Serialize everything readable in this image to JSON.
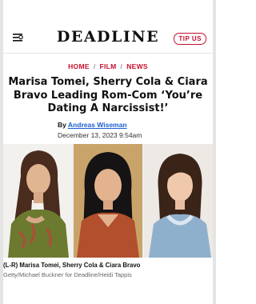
{
  "header": {
    "logo": "DEADLINE",
    "tip_label": "TIP US",
    "menu_icon": "menu-icon"
  },
  "breadcrumb": [
    "HOME",
    "FILM",
    "NEWS"
  ],
  "article": {
    "headline": "Marisa Tomei, Sherry Cola & Ciara Bravo Leading Rom-Com ‘You’re Dating A Narcissist!’",
    "by_label": "By",
    "author": "Andreas Wiseman",
    "date": "December 13, 2023 9:54am"
  },
  "photo": {
    "caption": "(L-R) Marisa Tomei, Sherry Cola & Ciara Bravo",
    "credit": "Getty/Michael Buckner for Deadline/Heidi Tappis"
  },
  "colors": {
    "accent": "#c8102e",
    "link": "#1a5fd1"
  }
}
